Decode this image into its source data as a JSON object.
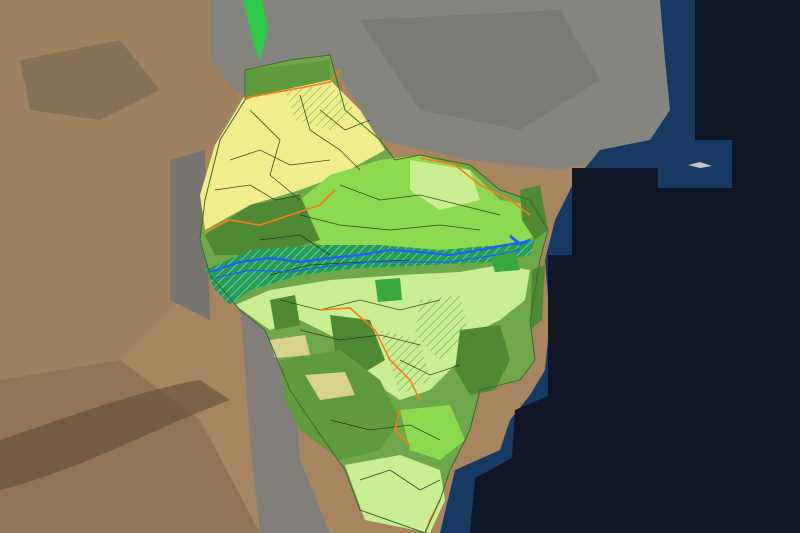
{
  "map": {
    "basemap": "satellite-imagery",
    "colors": {
      "land_tan": "#b08d66",
      "land_dark": "#8a6f52",
      "land_gray": "#8e8c86",
      "sea_shallow": "#173a63",
      "sea_deep": "#0f1726",
      "class_yellow": "#f2ed8c",
      "class_light_green": "#c9ef92",
      "class_bright_green": "#8fd94f",
      "class_mid_green": "#6fa84a",
      "class_dark_green": "#4e8a34",
      "class_vivid_green": "#2fc94a",
      "class_khaki": "#d8d28e",
      "outline_dark": "#2a2a1a",
      "outline_orange": "#ff7a1a",
      "river_blue": "#1f5fff",
      "hatch_cyan": "#3fd4d4"
    },
    "layers": [
      {
        "name": "land-cover-classification",
        "visible": true
      },
      {
        "name": "river-channel",
        "visible": true
      },
      {
        "name": "protected-area-outline",
        "visible": true
      }
    ]
  }
}
